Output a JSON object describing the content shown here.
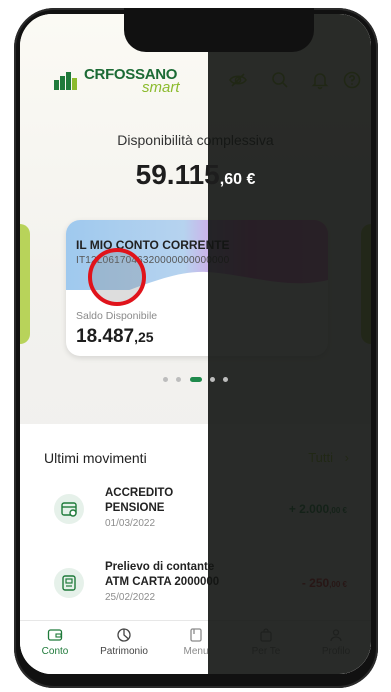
{
  "brand": {
    "name": "CRFOSSANO",
    "sub": "smart"
  },
  "header_icons": [
    "eye-off-icon",
    "search-icon",
    "bell-icon",
    "help-icon"
  ],
  "summary": {
    "label": "Disponibilità complessiva",
    "amount_int": "59.115",
    "amount_dec": ",60",
    "currency": "€"
  },
  "account_card": {
    "title": "IL MIO CONTO CORRENTE",
    "iban": "IT12L0617046320000000000000",
    "saldo_label": "Saldo Disponibile",
    "saldo_int": "18.487",
    "saldo_dec": ",25",
    "currency": "€"
  },
  "carousel": {
    "count": 5,
    "active_index": 2
  },
  "movements": {
    "title": "Ultimi movimenti",
    "all_label": "Tutti",
    "items": [
      {
        "desc_line1": "ACCREDITO",
        "desc_line2": "PENSIONE",
        "date": "01/03/2022",
        "amount_int": "+ 2.000",
        "amount_dec": ",00 €",
        "sign": "positive"
      },
      {
        "desc_line1": "Prelievo di contante",
        "desc_line2": "ATM CARTA 2000000",
        "date": "25/02/2022",
        "amount_int": "- 250",
        "amount_dec": ",00 €",
        "sign": "negative"
      }
    ]
  },
  "tabs": [
    {
      "label": "Conto",
      "icon": "wallet-icon",
      "active": true
    },
    {
      "label": "Patrimonio",
      "icon": "pie-chart-icon",
      "active": false
    },
    {
      "label": "Menu",
      "icon": "menu-book-icon",
      "active": false
    },
    {
      "label": "Per Te",
      "icon": "gift-bag-icon",
      "active": false
    },
    {
      "label": "Profilo",
      "icon": "user-icon",
      "active": false
    }
  ],
  "colors": {
    "brand_green": "#1c6b35",
    "accent_lime": "#a7cf3a",
    "positive": "#2e9c56",
    "negative": "#e4303a",
    "highlight_circle": "#e0131b"
  }
}
